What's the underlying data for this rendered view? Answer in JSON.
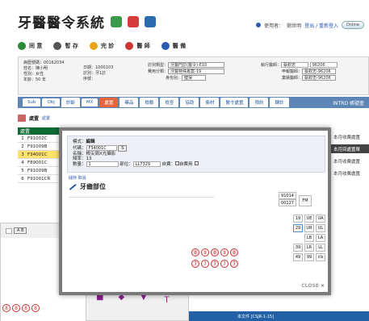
{
  "header": {
    "title": "牙醫醫令系統",
    "user_label": "使用者：",
    "user_name": "劉世明",
    "links": "登出 / 重新登入",
    "pill": "Online"
  },
  "toolbar": {
    "items": [
      {
        "label": "同 意",
        "icon": "agree-icon",
        "color": "#2a8a3a"
      },
      {
        "label": "暫 存",
        "icon": "save-icon",
        "color": "#555"
      },
      {
        "label": "完 診",
        "icon": "complete-icon",
        "color": "#e8a21b"
      },
      {
        "label": "醫 師",
        "icon": "doctor-icon",
        "color": "#c33"
      },
      {
        "label": "醫 備",
        "icon": "memo-icon",
        "color": "#2a5bb0"
      }
    ]
  },
  "patient": {
    "lines": [
      "病歷號碼：00162034",
      "姓名：陳小明",
      "性別：女性",
      "年齡：50 年"
    ],
    "date": "日期：1000103",
    "dept": "診別：牙1診",
    "seq": "序號：",
    "exam_type_label": "診別類型：",
    "exam_type_value": "牙醫門診(醫令)-E10",
    "diag_label": "費用分類：",
    "diag_value": "牙醫特殊專案-19",
    "identity_label": "身份別：",
    "identity_value": "健保",
    "doctor_label": "執行醫師：",
    "doctor_value": "蔡欽忠",
    "doctor_code": "96206",
    "main_doc_label": "申報醫師：",
    "main_doc_value": "蔡欽忠-96206",
    "chief_doc_label": "業績醫師：",
    "chief_doc_value": "蔡欽忠-96206"
  },
  "tabs": {
    "items": [
      "Sub",
      "Obj",
      "診斷",
      "MX",
      "處置",
      "藥品",
      "檢驗",
      "檢查",
      "協助",
      "衛材",
      "醫令處置",
      "預約",
      "轉診"
    ],
    "active": 4,
    "right": "INTRO 帳號查"
  },
  "list": {
    "header": "處置",
    "rows": [
      {
        "n": "1",
        "code": "F91002C"
      },
      {
        "n": "2",
        "code": "F91009B"
      },
      {
        "n": "3",
        "code": "F34001C"
      },
      {
        "n": "4",
        "code": "F89001C"
      },
      {
        "n": "5",
        "code": "F91009B"
      },
      {
        "n": "6",
        "code": "F91001CR"
      }
    ],
    "highlight_row": 2,
    "sub_labels": [
      "處置",
      "處置"
    ]
  },
  "modal": {
    "mode_label": "模式：",
    "mode_value": "編輯",
    "code_label": "代碼：",
    "code_value": "F34001C",
    "name_label": "名稱：",
    "name_value": "根尖周X光攝影",
    "dose_label": "劑量：",
    "dose_value": "1",
    "freq_label": "頻率：",
    "freq_value": "13",
    "qty_label": "數量：",
    "qty_value": "1",
    "part_label": "部位：",
    "part_value": "LL7329",
    "self_pay_label": "自費：",
    "self_pay_value": "自費用",
    "links": "儲存 取消",
    "section_title": "牙齒部位",
    "close_label": "CLOSE",
    "fm_codes": [
      "91014",
      "00127"
    ],
    "fm_button": "FM",
    "grid": [
      [
        "19",
        "UE",
        "UA"
      ],
      [
        "29",
        "UR",
        "UL"
      ],
      [
        "",
        "LB",
        "LA"
      ],
      [
        "39",
        "LR",
        "LL"
      ],
      [
        "49",
        "99",
        "cls"
      ]
    ],
    "tooth_rows": [
      [
        "8",
        "8",
        "8",
        "8",
        "8"
      ],
      [
        "7",
        "7",
        "7",
        "7",
        "7"
      ]
    ]
  },
  "sidepanel": {
    "items": [
      "本月收費處置",
      "本月回處置單",
      "本月收費處置",
      "本月收費處置"
    ]
  },
  "bottom_toolbar": "A B",
  "status": "本文件 [CSJR-1-15]"
}
